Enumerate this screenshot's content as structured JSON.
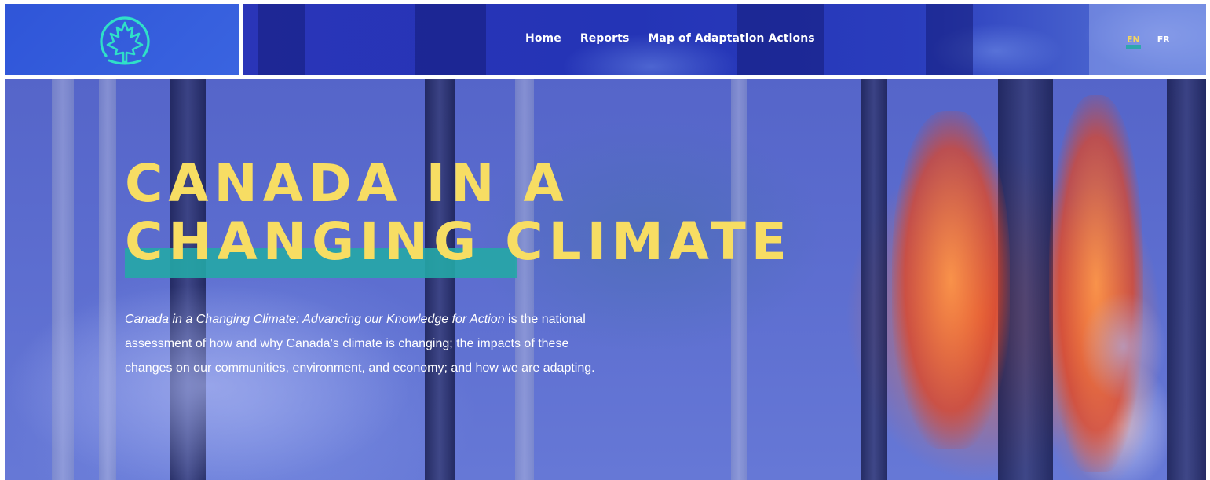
{
  "header": {
    "logo_icon": "maple-leaf-arc-icon",
    "nav": [
      {
        "label": "Home"
      },
      {
        "label": "Reports"
      },
      {
        "label": "Map of Adaptation Actions"
      }
    ],
    "languages": [
      {
        "label": "EN",
        "active": true
      },
      {
        "label": "FR",
        "active": false
      }
    ]
  },
  "hero": {
    "title_line1": "CANADA IN A",
    "title_line2": "CHANGING CLIMATE",
    "description_italic": "Canada in a Changing Climate: Advancing our Knowledge for Action",
    "description_rest": " is the national assessment of how and why Canada’s climate is changing; the impacts of these changes on our communities, environment, and economy; and how we are adapting."
  },
  "colors": {
    "title_yellow": "#f7dd63",
    "highlight_teal": "#25a7a6",
    "logo_teal": "#2fe0c8",
    "header_blue": "#2f55d8"
  }
}
